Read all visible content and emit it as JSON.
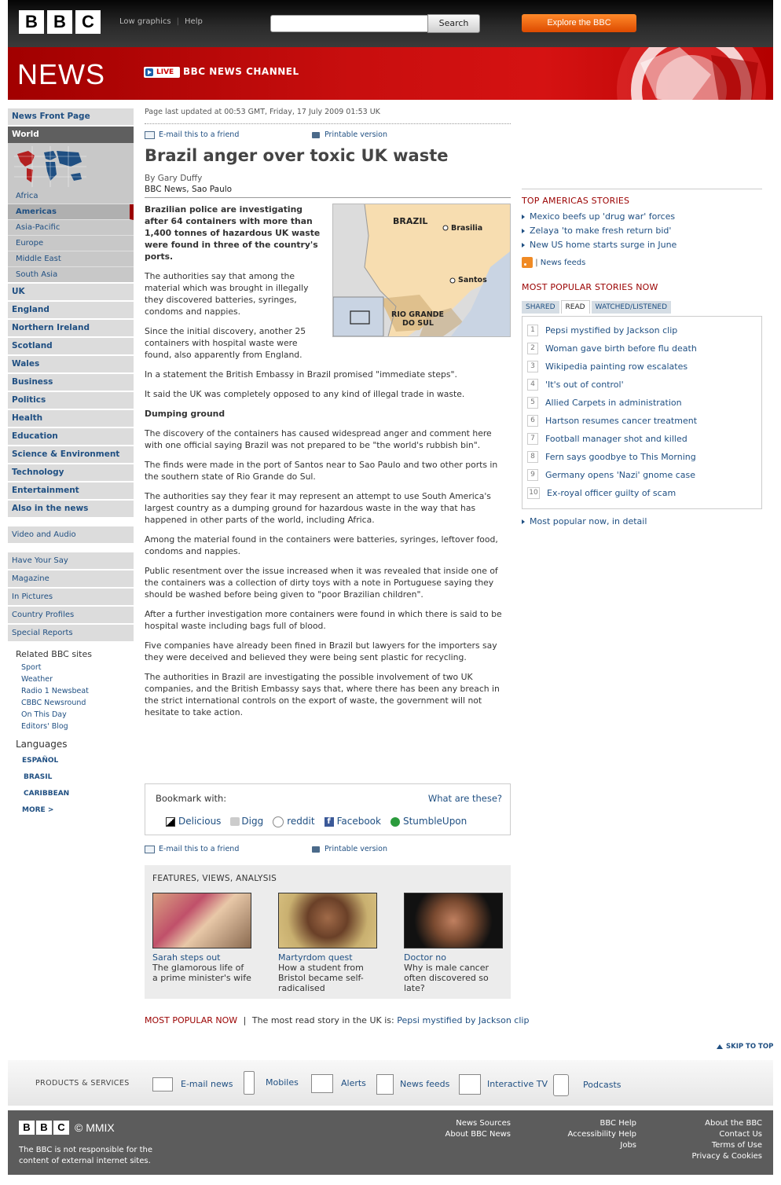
{
  "masthead": {
    "logo": "BBC",
    "links": [
      "Low graphics",
      "Help"
    ],
    "search_button": "Search",
    "explore_button": "Explore the BBC"
  },
  "banner": {
    "section": "NEWS",
    "live_label": "LIVE",
    "channel": "BBC NEWS CHANNEL"
  },
  "leftnav": {
    "top": "News Front Page",
    "world": "World",
    "world_sub": [
      "Africa",
      "Americas",
      "Asia-Pacific",
      "Europe",
      "Middle East",
      "South Asia"
    ],
    "sections": [
      "UK",
      "England",
      "Northern Ireland",
      "Scotland",
      "Wales",
      "Business",
      "Politics",
      "Health",
      "Education",
      "Science & Environment",
      "Technology",
      "Entertainment",
      "Also in the news"
    ],
    "video": "Video and Audio",
    "extras": [
      "Have Your Say",
      "Magazine",
      "In Pictures",
      "Country Profiles",
      "Special Reports"
    ],
    "related_title": "Related BBC sites",
    "related": [
      "Sport",
      "Weather",
      "Radio 1 Newsbeat",
      "CBBC Newsround",
      "On This Day",
      "Editors' Blog"
    ],
    "languages_title": "Languages",
    "languages": [
      "ESPAÑOL",
      "BRASIL",
      "CARIBBEAN",
      "MORE >"
    ]
  },
  "article": {
    "updated": "Page last updated at 00:53 GMT, Friday, 17 July 2009 01:53 UK",
    "email": "E-mail this to a friend",
    "print": "Printable version",
    "headline": "Brazil anger over toxic UK waste",
    "byline": "By Gary Duffy",
    "dateline": "BBC News, Sao Paulo",
    "lead": "Brazilian police are investigating after 64 containers with more than 1,400 tonnes of hazardous UK waste were found in three of the country's ports.",
    "p1": "The authorities say that among the material which was brought in illegally they discovered batteries, syringes, condoms and nappies.",
    "p2": "Since the initial discovery, another 25 containers with hospital waste were found, also apparently from England.",
    "p3": "In a statement the British Embassy in Brazil promised \"immediate steps\".",
    "p4": "It said the UK was completely opposed to any kind of illegal trade in waste.",
    "subhead": "Dumping ground",
    "p5": "The discovery of the containers has caused widespread anger and comment here with one official saying Brazil was not prepared to be \"the world's rubbish bin\".",
    "p6": "The finds were made in the port of Santos near to Sao Paulo and two other ports in the southern state of Rio Grande do Sul.",
    "p7": "The authorities say they fear it may represent an attempt to use South America's largest country as a dumping ground for hazardous waste in the way that has happened in other parts of the world, including Africa.",
    "p8": "Among the material found in the containers were batteries, syringes, leftover food, condoms and nappies.",
    "p9": "Public resentment over the issue increased when it was revealed that inside one of the containers was a collection of dirty toys with a note in Portuguese saying they should be washed before being given to \"poor Brazilian children\".",
    "p10": "After a further investigation more containers were found in which there is said to be hospital waste including bags full of blood.",
    "p11": "Five companies have already been fined in Brazil but lawyers for the importers say they were deceived and believed they were being sent plastic for recycling.",
    "p12": "The authorities in Brazil are investigating the possible involvement of two UK companies, and the British Embassy says that, where there has been any breach in the strict international controls on the export of waste, the government will not hesitate to take action."
  },
  "map": {
    "country": "BRAZIL",
    "city1": "Brasilia",
    "city2": "Santos",
    "region_line1": "RIO GRANDE",
    "region_line2": "DO SUL"
  },
  "bookmark": {
    "label": "Bookmark with:",
    "what": "What are these?",
    "services": [
      "Delicious",
      "Digg",
      "reddit",
      "Facebook",
      "StumbleUpon"
    ]
  },
  "features": {
    "title": "FEATURES, VIEWS, ANALYSIS",
    "items": [
      {
        "title": "Sarah steps out",
        "desc": "The glamorous life of a prime minister's wife"
      },
      {
        "title": "Martyrdom quest",
        "desc": "How a student from Bristol became self-radicalised"
      },
      {
        "title": "Doctor no",
        "desc": "Why is male cancer often discovered so late?"
      }
    ]
  },
  "mostpopular_strip": {
    "label": "MOST POPULAR NOW",
    "text": "The most read story in the UK is:",
    "link": "Pepsi mystified by Jackson clip"
  },
  "right": {
    "top_title": "TOP AMERICAS STORIES",
    "top_stories": [
      "Mexico beefs up 'drug war' forces",
      "Zelaya 'to make fresh return bid'",
      "New US home starts surge in June"
    ],
    "feeds": "News feeds",
    "popular_title": "MOST POPULAR STORIES NOW",
    "tabs": [
      "SHARED",
      "READ",
      "WATCHED/LISTENED"
    ],
    "popular": [
      "Pepsi mystified by Jackson clip",
      "Woman gave birth before flu death",
      "Wikipedia painting row escalates",
      "'It's out of control'",
      "Allied Carpets in administration",
      "Hartson resumes cancer treatment",
      "Football manager shot and killed",
      "Fern says goodbye to This Morning",
      "Germany opens 'Nazi' gnome case",
      "Ex-royal officer guilty of scam"
    ],
    "popular_numbers": [
      "1",
      "2",
      "3",
      "4",
      "5",
      "6",
      "7",
      "8",
      "9",
      "10"
    ],
    "detail": "Most popular now, in detail"
  },
  "skip": "SKIP TO TOP",
  "products": {
    "label": "PRODUCTS & SERVICES",
    "items": [
      "E-mail news",
      "Mobiles",
      "Alerts",
      "News feeds",
      "Interactive TV",
      "Podcasts"
    ]
  },
  "footer": {
    "copyright": "© MMIX",
    "disclaimer_line1": "The BBC is not responsible for the",
    "disclaimer_line2": "content of external internet sites.",
    "col1": [
      "News Sources",
      "About BBC News"
    ],
    "col2": [
      "BBC Help",
      "Accessibility Help",
      "Jobs"
    ],
    "col3": [
      "About the BBC",
      "Contact Us",
      "Terms of Use",
      "Privacy & Cookies"
    ]
  },
  "colors": {
    "accent_red": "#9a0000",
    "link_blue": "#1f4f82",
    "banner_red": "#c80e0e",
    "explore_orange": "#ee6411"
  }
}
